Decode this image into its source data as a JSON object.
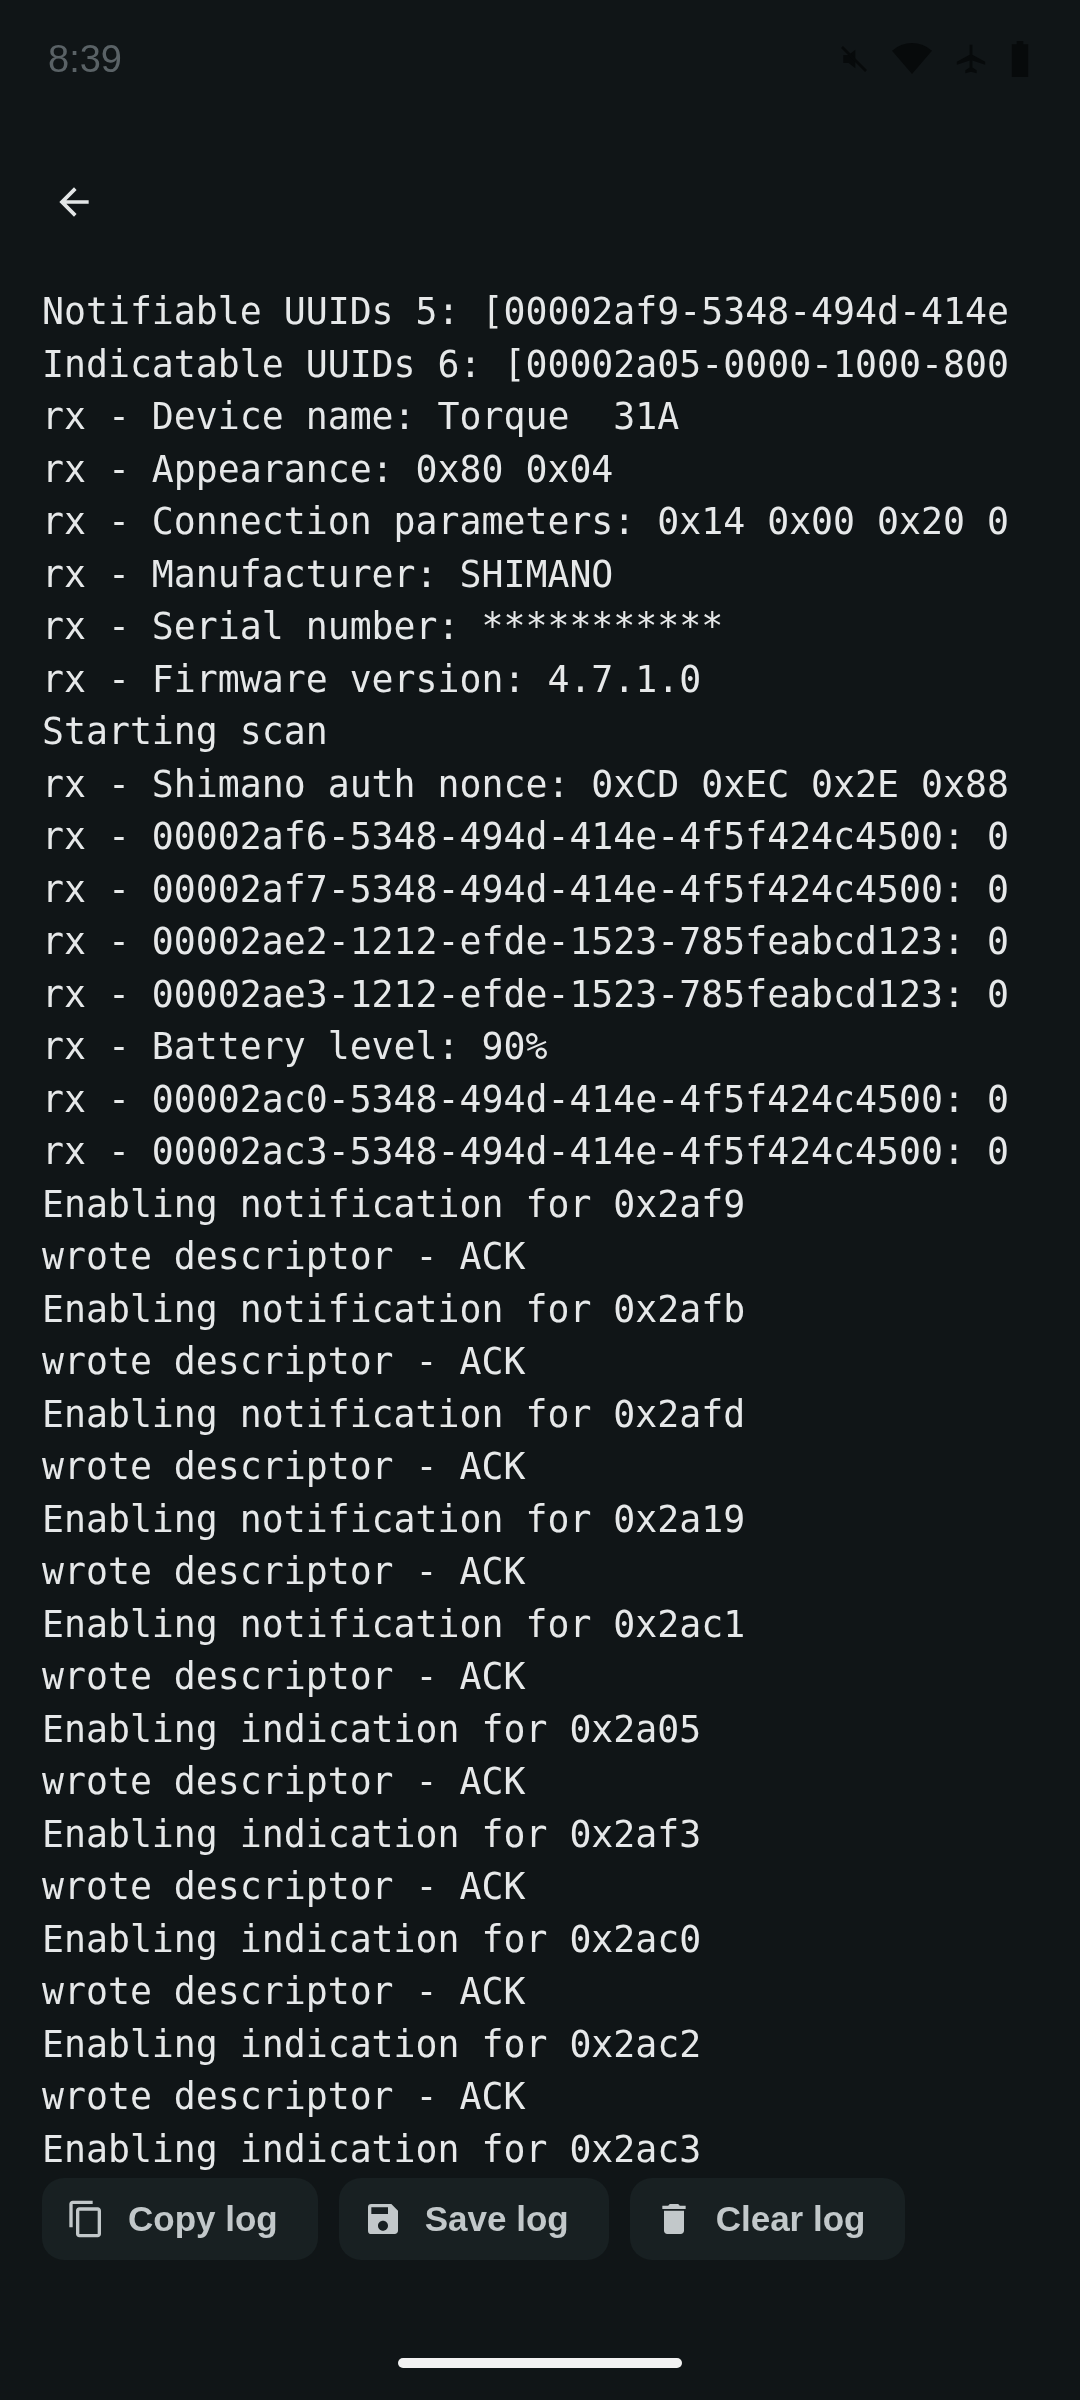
{
  "status_bar": {
    "time": "8:39"
  },
  "log": {
    "lines": [
      "Notifiable UUIDs 5: [00002af9-5348-494d-414e",
      "Indicatable UUIDs 6: [00002a05-0000-1000-800",
      "rx - Device name: Torque  31A",
      "rx - Appearance: 0x80 0x04",
      "rx - Connection parameters: 0x14 0x00 0x20 0",
      "rx - Manufacturer: SHIMANO",
      "rx - Serial number: ***********",
      "rx - Firmware version: 4.7.1.0",
      "Starting scan",
      "rx - Shimano auth nonce: 0xCD 0xEC 0x2E 0x88",
      "rx - 00002af6-5348-494d-414e-4f5f424c4500: 0",
      "rx - 00002af7-5348-494d-414e-4f5f424c4500: 0",
      "rx - 00002ae2-1212-efde-1523-785feabcd123: 0",
      "rx - 00002ae3-1212-efde-1523-785feabcd123: 0",
      "rx - Battery level: 90%",
      "rx - 00002ac0-5348-494d-414e-4f5f424c4500: 0",
      "rx - 00002ac3-5348-494d-414e-4f5f424c4500: 0",
      "Enabling notification for 0x2af9",
      "wrote descriptor - ACK",
      "Enabling notification for 0x2afb",
      "wrote descriptor - ACK",
      "Enabling notification for 0x2afd",
      "wrote descriptor - ACK",
      "Enabling notification for 0x2a19",
      "wrote descriptor - ACK",
      "Enabling notification for 0x2ac1",
      "wrote descriptor - ACK",
      "Enabling indication for 0x2a05",
      "wrote descriptor - ACK",
      "Enabling indication for 0x2af3",
      "wrote descriptor - ACK",
      "Enabling indication for 0x2ac0",
      "wrote descriptor - ACK",
      "Enabling indication for 0x2ac2",
      "wrote descriptor - ACK",
      "Enabling indication for 0x2ac3"
    ]
  },
  "buttons": [
    {
      "label": "Copy log",
      "kind": "copy"
    },
    {
      "label": "Save log",
      "kind": "save"
    },
    {
      "label": "Clear log",
      "kind": "clear"
    }
  ]
}
